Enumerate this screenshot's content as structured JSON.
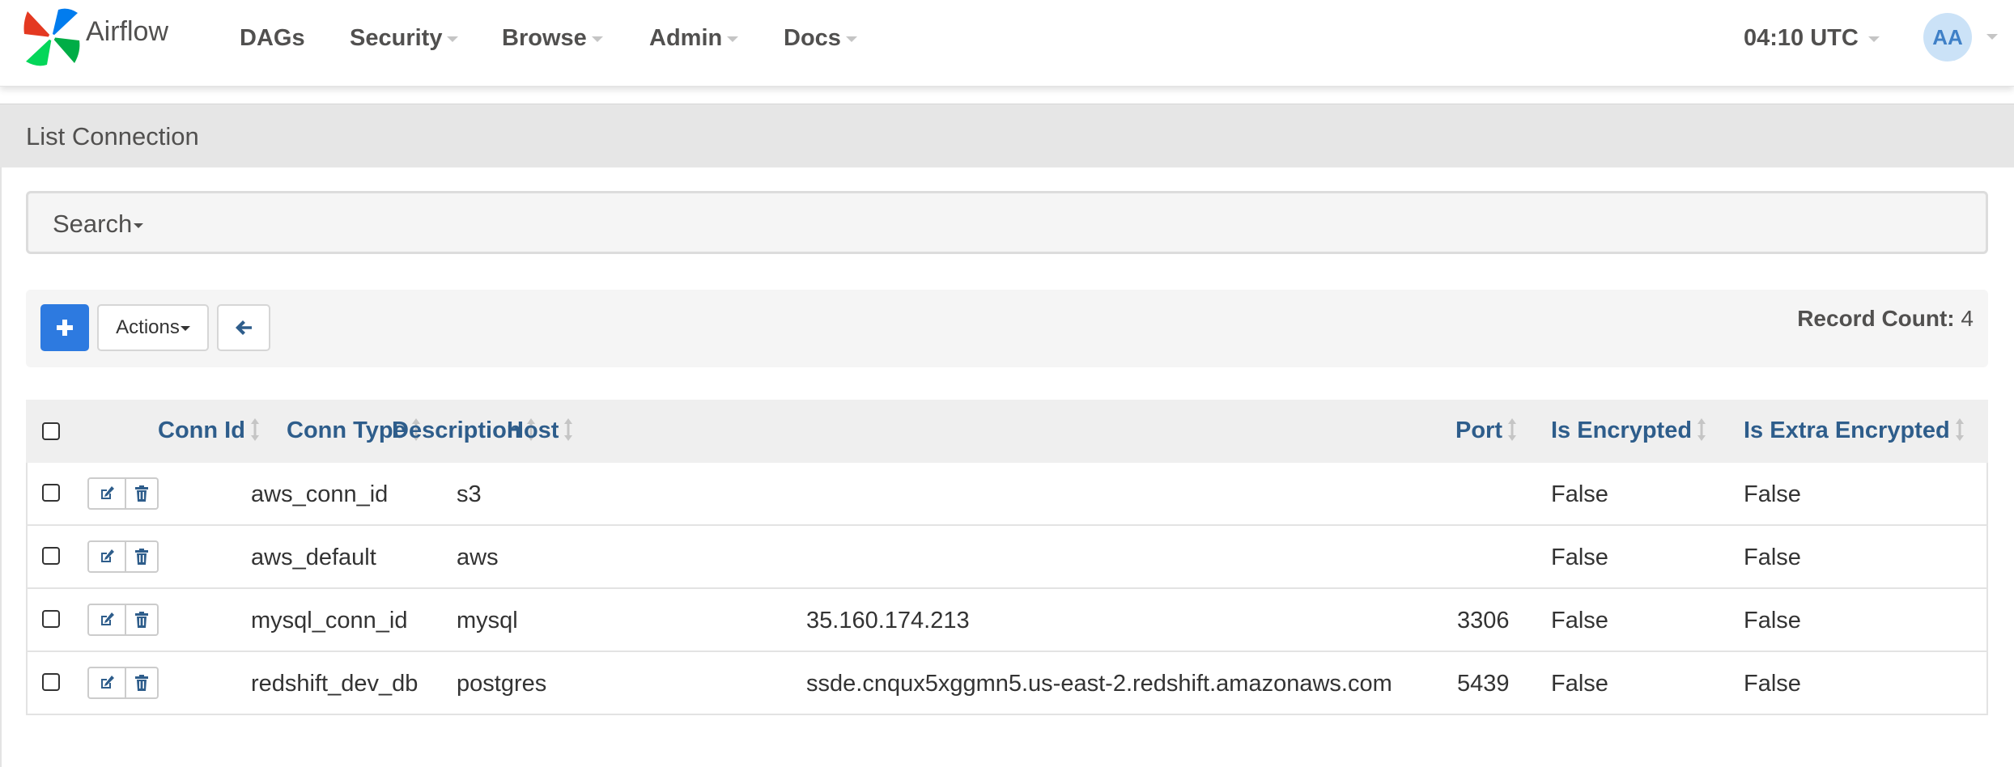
{
  "navbar": {
    "brand": "Airflow",
    "menu": [
      {
        "label": "DAGs",
        "dropdown": false
      },
      {
        "label": "Security",
        "dropdown": true
      },
      {
        "label": "Browse",
        "dropdown": true
      },
      {
        "label": "Admin",
        "dropdown": true
      },
      {
        "label": "Docs",
        "dropdown": true
      }
    ],
    "clock": "04:10 UTC",
    "user_initials": "AA"
  },
  "page": {
    "title": "List Connection",
    "search_label": "Search",
    "actions_label": "Actions",
    "record_count_label": "Record Count:",
    "record_count": "4"
  },
  "table": {
    "columns": [
      "Conn Id",
      "Conn Type",
      "Description",
      "Host",
      "Port",
      "Is Encrypted",
      "Is Extra Encrypted"
    ],
    "rows": [
      {
        "conn_id": "aws_conn_id",
        "conn_type": "s3",
        "description": "",
        "host": "",
        "port": "",
        "is_encrypted": "False",
        "is_extra_encrypted": "False"
      },
      {
        "conn_id": "aws_default",
        "conn_type": "aws",
        "description": "",
        "host": "",
        "port": "",
        "is_encrypted": "False",
        "is_extra_encrypted": "False"
      },
      {
        "conn_id": "mysql_conn_id",
        "conn_type": "mysql",
        "description": "",
        "host": "35.160.174.213",
        "port": "3306",
        "is_encrypted": "False",
        "is_extra_encrypted": "False"
      },
      {
        "conn_id": "redshift_dev_db",
        "conn_type": "postgres",
        "description": "",
        "host": "ssde.cnqux5xggmn5.us-east-2.redshift.amazonaws.com",
        "port": "5439",
        "is_encrypted": "False",
        "is_extra_encrypted": "False"
      }
    ]
  },
  "icons": {
    "add": "plus-icon",
    "back": "arrow-left-icon",
    "edit": "edit-icon",
    "delete": "trash-icon",
    "sort": "sort-icon"
  },
  "colors": {
    "primary": "#2d7ae0",
    "link": "#2e5d8b",
    "avatar_bg": "#cbe2f7"
  }
}
